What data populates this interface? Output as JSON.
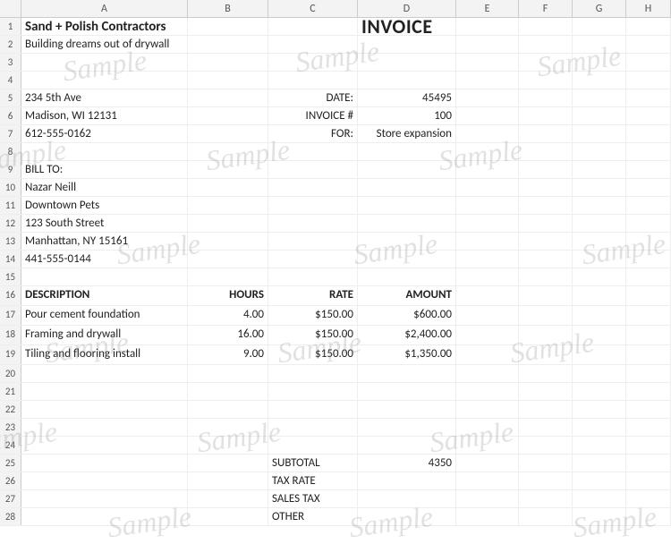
{
  "columns": [
    "A",
    "B",
    "C",
    "D",
    "E",
    "F",
    "G",
    "H"
  ],
  "company": {
    "name": "Sand + Polish Contractors",
    "tagline": "Building dreams out of drywall",
    "address1": "234 5th Ave",
    "address2": "Madison, WI 12131",
    "phone": "612-555-0162"
  },
  "invoice_title": "INVOICE",
  "meta": {
    "date_label": "DATE:",
    "date_value": "45495",
    "number_label": "INVOICE #",
    "number_value": "100",
    "for_label": "FOR:",
    "for_value": "Store expansion"
  },
  "bill_to": {
    "label": "BILL TO:",
    "name": "Nazar Neill",
    "company": "Downtown Pets",
    "address1": "123 South Street",
    "address2": "Manhattan, NY 15161",
    "phone": "441-555-0144"
  },
  "headers": {
    "description": "DESCRIPTION",
    "hours": "HOURS",
    "rate": "RATE",
    "amount": "AMOUNT"
  },
  "items": [
    {
      "description": "Pour cement foundation",
      "hours": "4.00",
      "rate": "$150.00",
      "amount": "$600.00"
    },
    {
      "description": "Framing and drywall",
      "hours": "16.00",
      "rate": "$150.00",
      "amount": "$2,400.00"
    },
    {
      "description": "Tiling and flooring install",
      "hours": "9.00",
      "rate": "$150.00",
      "amount": "$1,350.00"
    }
  ],
  "totals": {
    "subtotal_label": "SUBTOTAL",
    "subtotal_value": "4350",
    "tax_rate_label": "TAX RATE",
    "sales_tax_label": "SALES TAX",
    "other_label": "OTHER"
  },
  "watermark_text": "Sample"
}
